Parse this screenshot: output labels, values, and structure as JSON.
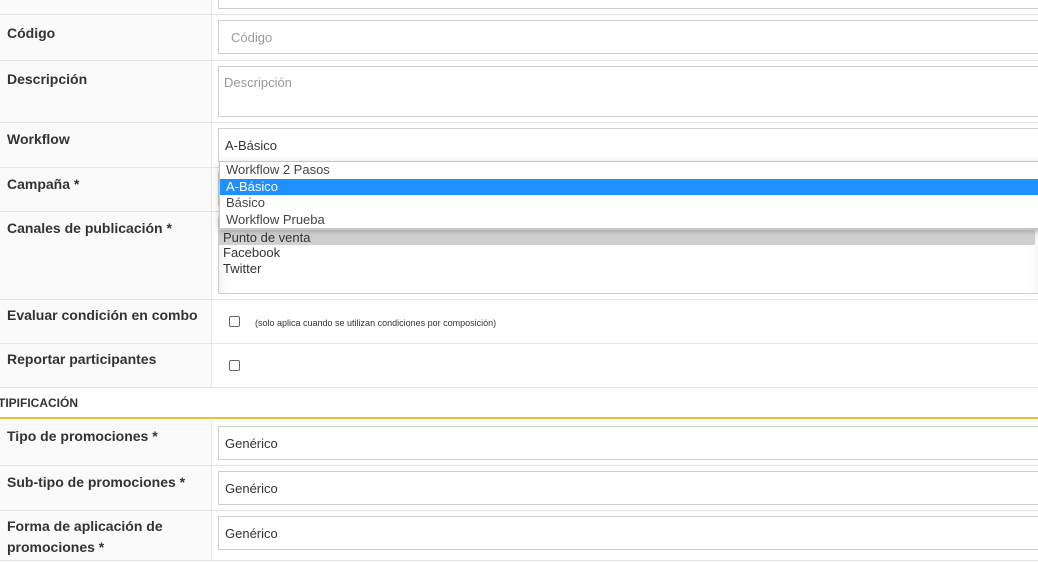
{
  "form": {
    "codigo": {
      "label": "Código",
      "placeholder": "Código"
    },
    "descripcion": {
      "label": "Descripción",
      "placeholder": "Descripción"
    },
    "workflow": {
      "label": "Workflow",
      "value": "A-Básico",
      "options": [
        "Workflow 2 Pasos",
        "A-Básico",
        "Básico",
        "Workflow Prueba"
      ],
      "selected_option": "A-Básico"
    },
    "campana": {
      "label": "Campaña *"
    },
    "canales": {
      "label": "Canales de publicación *",
      "items": [
        "Punto de venta",
        "Facebook",
        "Twitter"
      ]
    },
    "evaluar": {
      "label": "Evaluar condición en combo",
      "note": "(solo aplica cuando se utilizan condiciones por composición)"
    },
    "reportar": {
      "label": "Reportar participantes"
    }
  },
  "section": {
    "title": "TIPIFICACIÓN"
  },
  "tipificacion": {
    "tipo": {
      "label": "Tipo de promociones *",
      "value": "Genérico"
    },
    "subtipo": {
      "label": "Sub-tipo de promociones *",
      "value": "Genérico"
    },
    "forma": {
      "label_line1": "Forma de aplicación de",
      "label_line2": "promociones *",
      "value": "Genérico"
    }
  },
  "colors": {
    "accent_selection": "#1e90ff",
    "section_underline": "#e8c23c"
  }
}
